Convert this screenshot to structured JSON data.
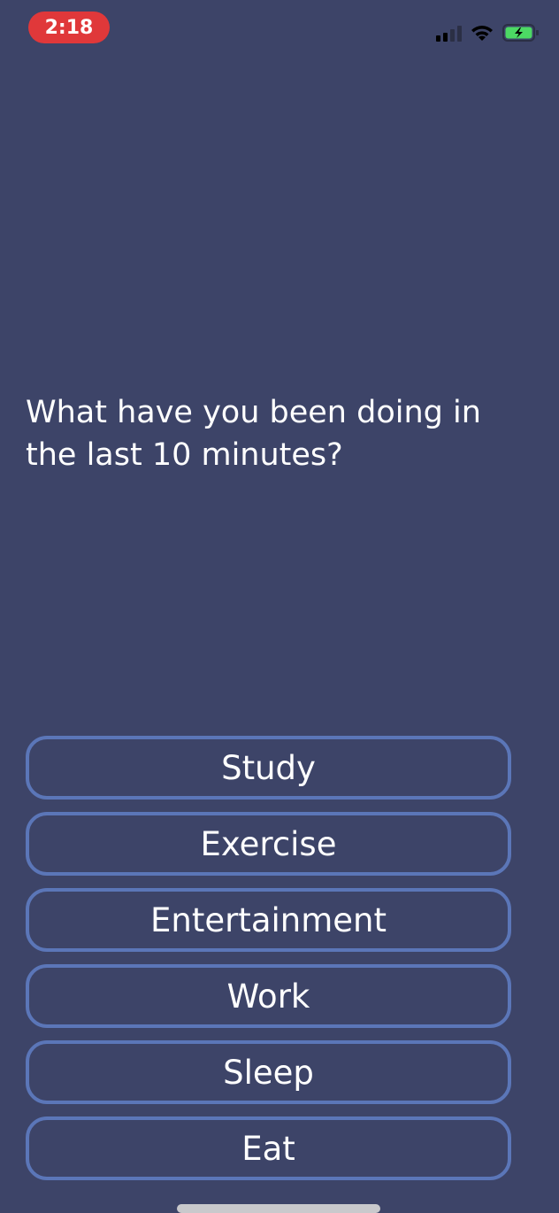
{
  "status_bar": {
    "time": "2:18",
    "icons": [
      "cellular-signal-icon",
      "wifi-icon",
      "battery-charging-icon"
    ],
    "time_pill_color": "#e0383a",
    "battery_color": "#4cd964"
  },
  "question": {
    "text": "What have you been doing in the last 10 minutes?"
  },
  "options": [
    {
      "label": "Study"
    },
    {
      "label": "Exercise"
    },
    {
      "label": "Entertainment"
    },
    {
      "label": "Work"
    },
    {
      "label": "Sleep"
    },
    {
      "label": "Eat"
    }
  ],
  "colors": {
    "background": "#3d4468",
    "button_border": "#5b76b8",
    "text": "#ffffff"
  }
}
